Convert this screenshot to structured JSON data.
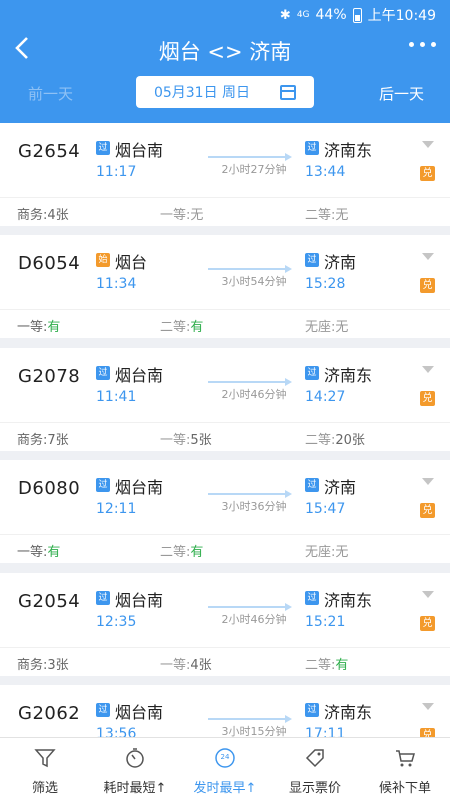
{
  "status": {
    "network": "4G",
    "battery": "44%",
    "time": "上午10:49"
  },
  "nav": {
    "title": "烟台 <> 济南"
  },
  "datebar": {
    "prev": "前一天",
    "date": "05月31日 周日",
    "next": "后一天"
  },
  "tags": {
    "pass": "过",
    "start": "始",
    "exchange": "兑"
  },
  "trains": [
    {
      "code": "G2654",
      "from_tag": "过",
      "from": "烟台南",
      "dep": "11:17",
      "duration": "2小时27分钟",
      "to_tag": "过",
      "to": "济南东",
      "arr": "13:44",
      "seats": [
        {
          "k": "商务:",
          "v": "4张"
        },
        {
          "k": "一等:",
          "v": "无"
        },
        {
          "k": "二等:",
          "v": "无"
        }
      ]
    },
    {
      "code": "D6054",
      "from_tag": "始",
      "from": "烟台",
      "dep": "11:34",
      "duration": "3小时54分钟",
      "to_tag": "过",
      "to": "济南",
      "arr": "15:28",
      "seats": [
        {
          "k": "一等:",
          "v": "有"
        },
        {
          "k": "二等:",
          "v": "有"
        },
        {
          "k": "无座:",
          "v": "无"
        }
      ]
    },
    {
      "code": "G2078",
      "from_tag": "过",
      "from": "烟台南",
      "dep": "11:41",
      "duration": "2小时46分钟",
      "to_tag": "过",
      "to": "济南东",
      "arr": "14:27",
      "seats": [
        {
          "k": "商务:",
          "v": "7张"
        },
        {
          "k": "一等:",
          "v": "5张"
        },
        {
          "k": "二等:",
          "v": "20张"
        }
      ]
    },
    {
      "code": "D6080",
      "from_tag": "过",
      "from": "烟台南",
      "dep": "12:11",
      "duration": "3小时36分钟",
      "to_tag": "过",
      "to": "济南",
      "arr": "15:47",
      "seats": [
        {
          "k": "一等:",
          "v": "有"
        },
        {
          "k": "二等:",
          "v": "有"
        },
        {
          "k": "无座:",
          "v": "无"
        }
      ]
    },
    {
      "code": "G2054",
      "from_tag": "过",
      "from": "烟台南",
      "dep": "12:35",
      "duration": "2小时46分钟",
      "to_tag": "过",
      "to": "济南东",
      "arr": "15:21",
      "seats": [
        {
          "k": "商务:",
          "v": "3张"
        },
        {
          "k": "一等:",
          "v": "4张"
        },
        {
          "k": "二等:",
          "v": "有"
        }
      ]
    },
    {
      "code": "G2062",
      "from_tag": "过",
      "from": "烟台南",
      "dep": "13:56",
      "duration": "3小时15分钟",
      "to_tag": "过",
      "to": "济南东",
      "arr": "17:11",
      "seats": []
    }
  ],
  "bottom": [
    {
      "label": "筛选",
      "icon": "filter-icon"
    },
    {
      "label": "耗时最短↑",
      "icon": "stopwatch-icon"
    },
    {
      "label": "发时最早↑",
      "icon": "clock-24-icon",
      "badge": "24",
      "active": true
    },
    {
      "label": "显示票价",
      "icon": "price-tag-icon"
    },
    {
      "label": "候补下单",
      "icon": "cart-icon"
    }
  ],
  "colors": {
    "primary": "#3d96ee",
    "orange": "#f39a2c",
    "green": "#2fae4c"
  }
}
